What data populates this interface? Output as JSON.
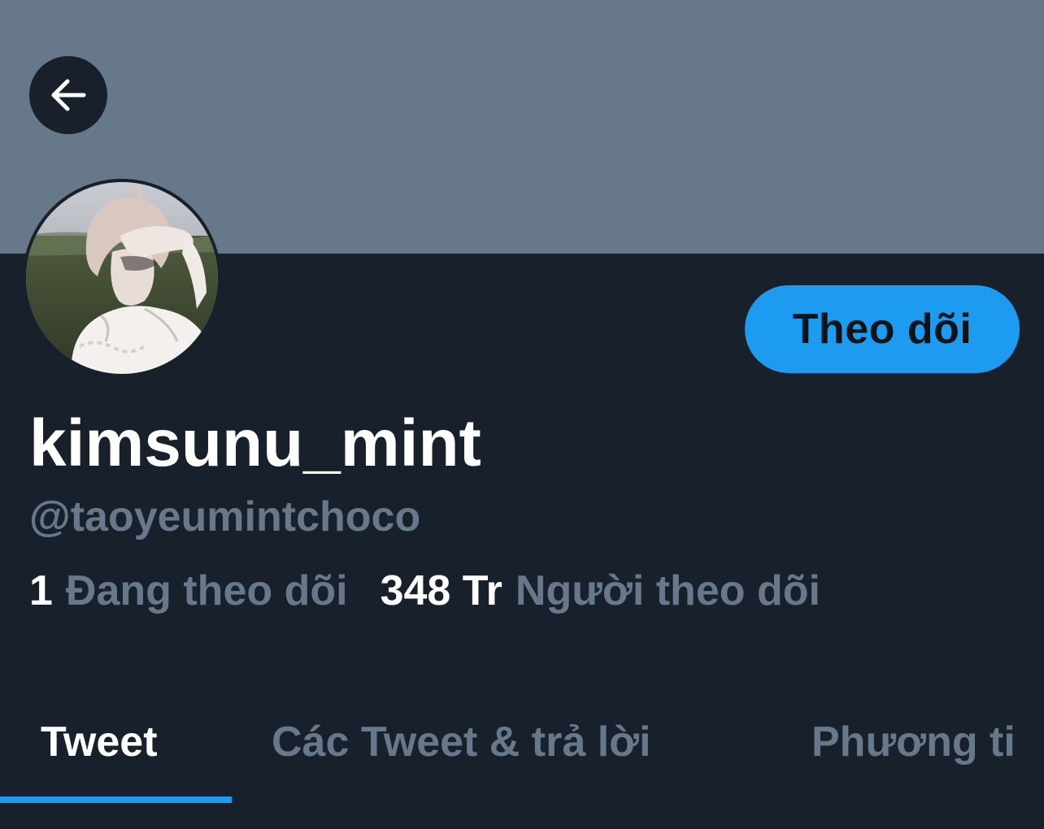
{
  "colors": {
    "banner": "#66788a",
    "background": "#17202b",
    "accent": "#1d9bf0",
    "muted_text": "#66788a",
    "primary_text": "#ffffff"
  },
  "header": {
    "back_icon": "arrow-left-icon"
  },
  "profile": {
    "display_name": "kimsunu_mint",
    "handle": "@taoyeumintchoco",
    "follow_label": "Theo dõi",
    "following_count": "1",
    "following_label": "Đang theo dõi",
    "followers_count": "348 Tr",
    "followers_label": "Người theo dõi"
  },
  "tabs": [
    {
      "label": "Tweet",
      "active": true
    },
    {
      "label": "Các Tweet & trả lời",
      "active": false
    },
    {
      "label": "Phương ti",
      "active": false
    }
  ]
}
